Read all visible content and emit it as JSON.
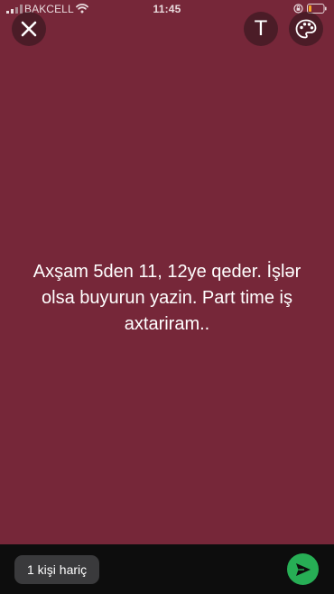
{
  "status_bar": {
    "carrier": "BAKCELL",
    "time": "11:45"
  },
  "toolbar": {
    "text_tool_label": "T"
  },
  "story": {
    "text": "Axşam 5den 11, 12ye qeder. İşlər olsa buyurun yazin.  Part time iş axtariram..",
    "background_color": "#762739"
  },
  "bottom_bar": {
    "audience_label": "1 kişi hariç",
    "send_color": "#27ae55"
  },
  "icons": [
    "signal-icon",
    "wifi-icon",
    "rotation-lock-icon",
    "battery-icon",
    "close-icon",
    "palette-icon",
    "send-icon"
  ]
}
